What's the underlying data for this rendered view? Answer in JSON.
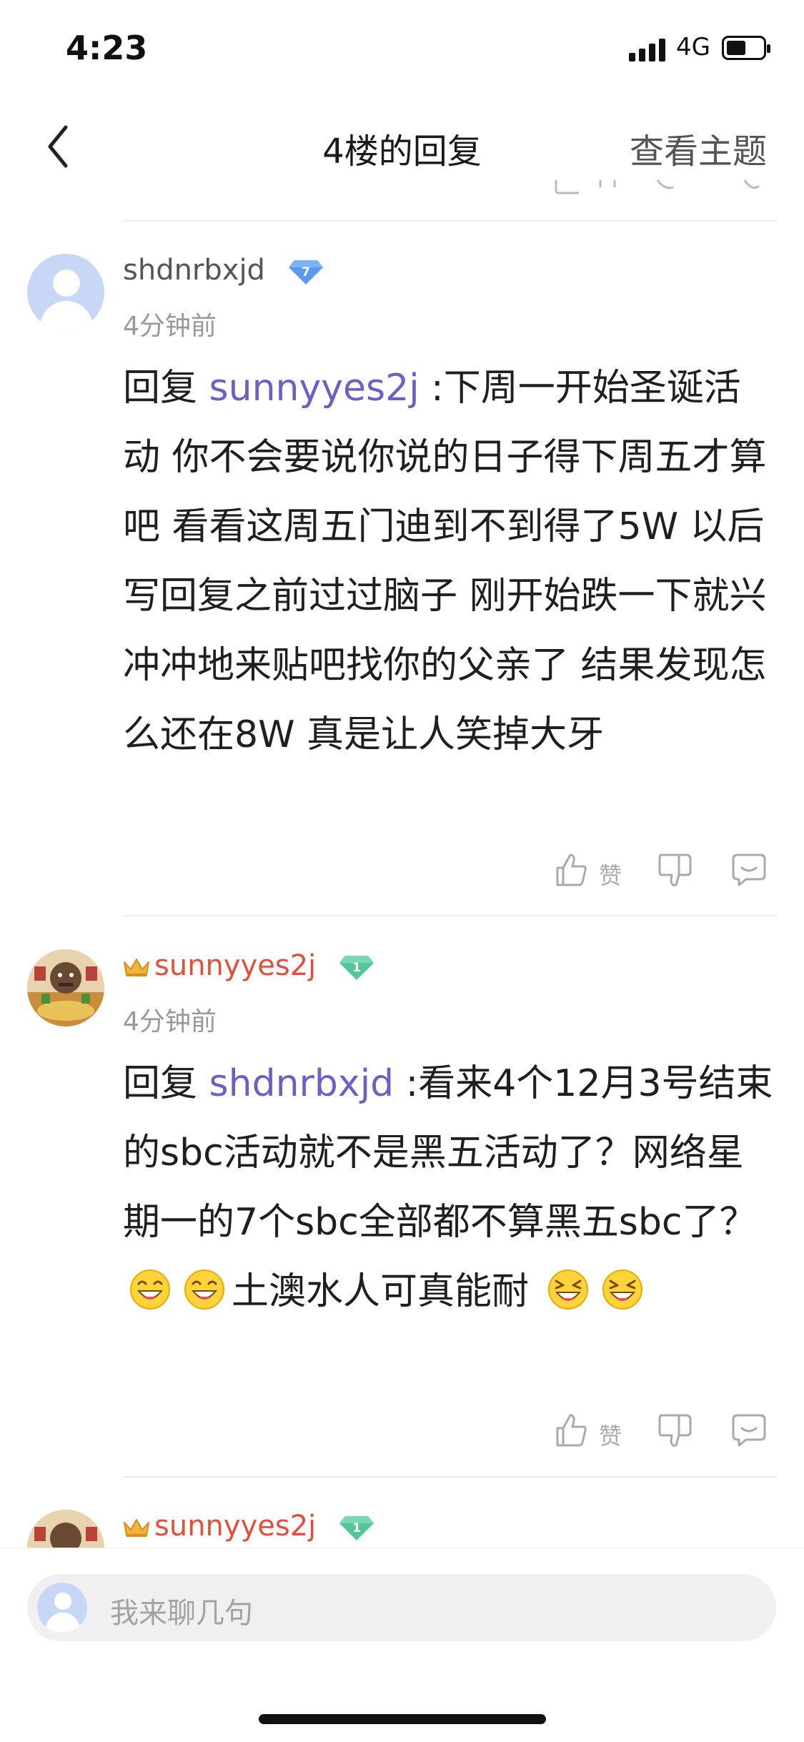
{
  "status_bar": {
    "time": "4:23",
    "network": "4G"
  },
  "nav": {
    "title": "4楼的回复",
    "right_link": "查看主题"
  },
  "comments": [
    {
      "username": "shdnrbxjd",
      "badge_level": "7",
      "time_ago": "4分钟前",
      "reply_prefix": "回复 ",
      "mention": "sunnyyes2j",
      "text": " :下周一开始圣诞活动 你不会要说你说的日子得下周五才算吧 看看这周五门迪到不到得了5W 以后写回复之前过过脑子 刚开始跌一下就兴冲冲地来贴吧找你的父亲了 结果发现怎么还在8W 真是让人笑掉大牙",
      "like_label": "赞"
    },
    {
      "username": "sunnyyes2j",
      "badge_level": "1",
      "time_ago": "4分钟前",
      "reply_prefix": "回复 ",
      "mention": "shdnrbxjd",
      "text_part1": " :看来4个12月3号结束的sbc活动就不是黑五活动了？网络星期一的7个sbc全部都不算黑五sbc了？",
      "text_part2": "土澳水人可真能耐",
      "like_label": "赞"
    },
    {
      "username": "sunnyyes2j",
      "badge_level": "1"
    }
  ],
  "input": {
    "placeholder": "我来聊几句"
  },
  "colors": {
    "mention": "#6c5fc7",
    "vip_name": "#e2503c",
    "blue_badge": "#5b9af0",
    "green_badge": "#52c79a"
  },
  "icons": [
    "back-arrow-icon",
    "like-icon",
    "dislike-icon",
    "reply-icon",
    "crown-icon",
    "diamond-badge-icon",
    "grin-emoji-icon",
    "laugh-emoji-icon"
  ]
}
